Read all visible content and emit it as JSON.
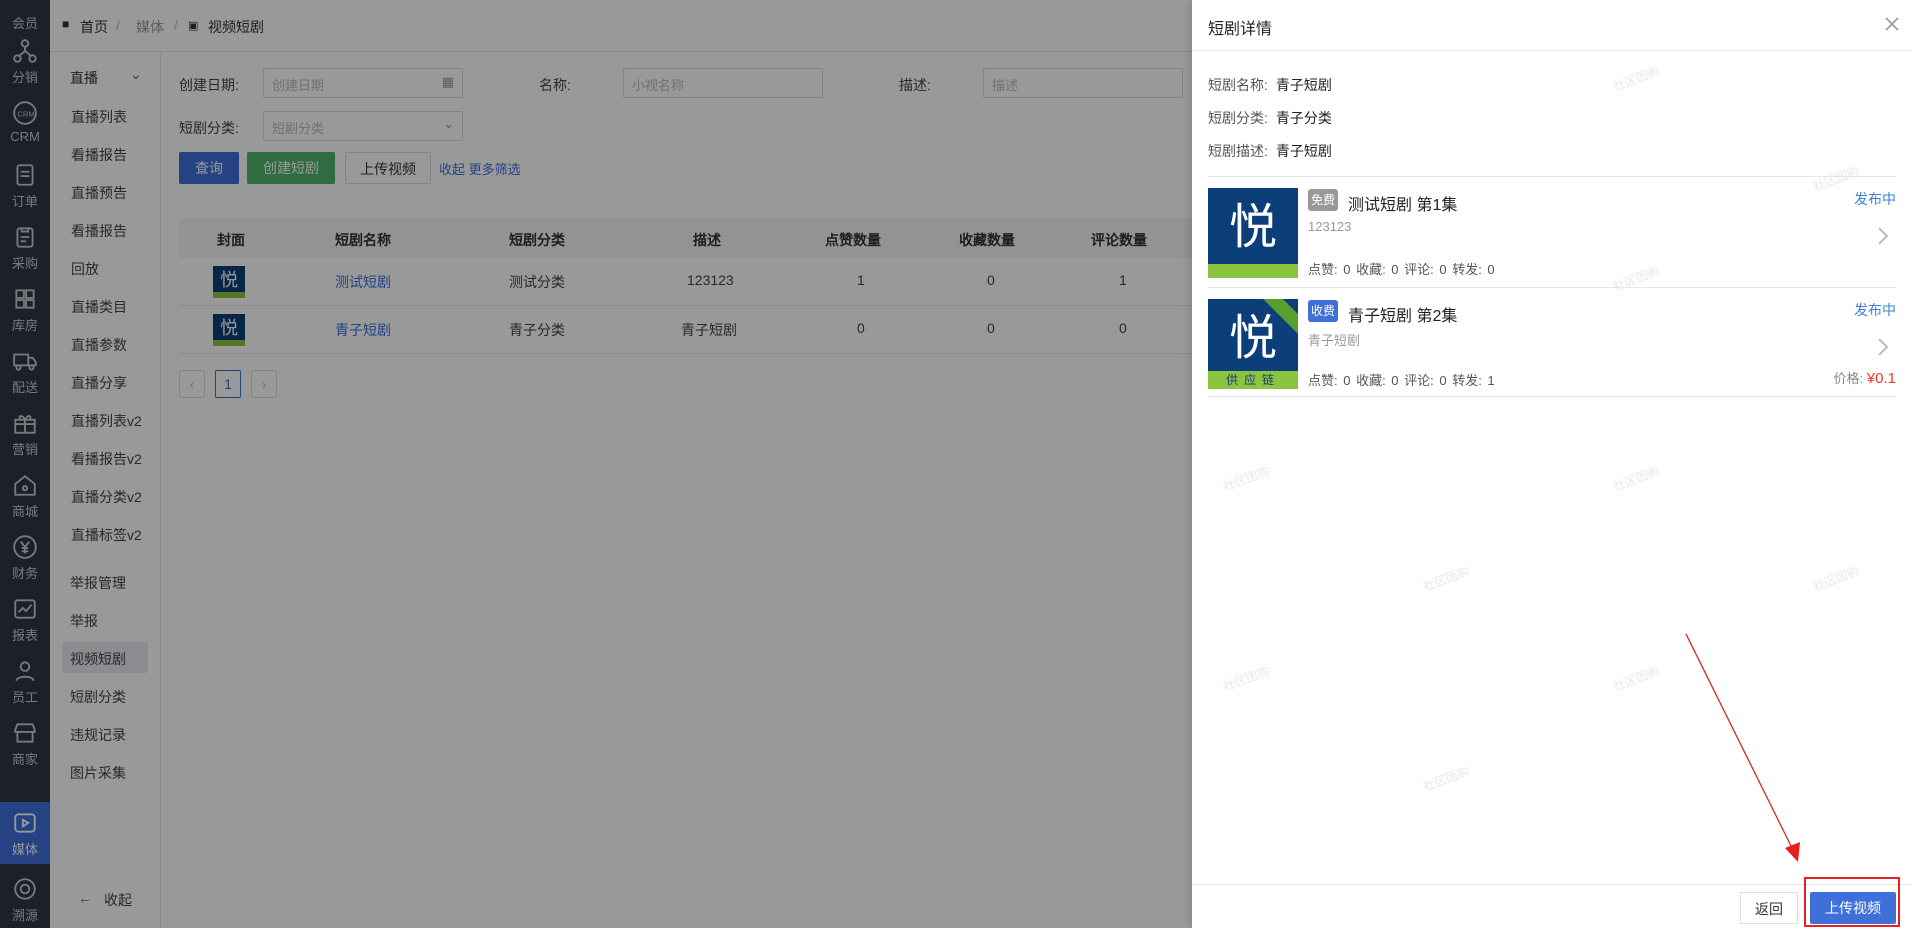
{
  "rail": [
    {
      "label": "会员",
      "icon": "member-icon"
    },
    {
      "label": "分销",
      "icon": "distribution-icon"
    },
    {
      "label": "CRM",
      "icon": "crm-icon"
    },
    {
      "label": "订单",
      "icon": "order-icon"
    },
    {
      "label": "采购",
      "icon": "purchase-icon"
    },
    {
      "label": "库房",
      "icon": "warehouse-icon"
    },
    {
      "label": "配送",
      "icon": "delivery-icon"
    },
    {
      "label": "营销",
      "icon": "gift-icon"
    },
    {
      "label": "商城",
      "icon": "mall-icon"
    },
    {
      "label": "财务",
      "icon": "finance-icon"
    },
    {
      "label": "报表",
      "icon": "report-icon"
    },
    {
      "label": "员工",
      "icon": "staff-icon"
    },
    {
      "label": "商家",
      "icon": "shop-icon"
    },
    {
      "label": "媒体",
      "icon": "media-icon"
    },
    {
      "label": "溯源",
      "icon": "trace-icon"
    }
  ],
  "breadcrumb": {
    "home": "首页",
    "media": "媒体",
    "current": "视频短剧"
  },
  "subnav": {
    "group": "直播",
    "items": [
      "直播列表",
      "看播报告",
      "直播预告",
      "看播报告",
      "回放",
      "直播类目",
      "直播参数",
      "直播分享",
      "直播列表v2",
      "看播报告v2",
      "直播分类v2",
      "直播标签v2"
    ],
    "items2": [
      "举报管理",
      "举报",
      "视频短剧",
      "短剧分类",
      "违规记录",
      "图片采集"
    ],
    "collapse": "收起"
  },
  "filters": {
    "date_label": "创建日期:",
    "date_placeholder": "创建日期",
    "name_label": "名称:",
    "name_placeholder": "小视名称",
    "desc_label": "描述:",
    "desc_placeholder": "描述",
    "cat_label": "短剧分类:",
    "cat_placeholder": "短剧分类",
    "query": "查询",
    "create": "创建短剧",
    "upload": "上传视频",
    "more": "收起 更多筛选"
  },
  "table": {
    "headers": [
      "封面",
      "短剧名称",
      "短剧分类",
      "描述",
      "点赞数量",
      "收藏数量",
      "评论数量"
    ],
    "rows": [
      {
        "name": "测试短剧",
        "category": "测试分类",
        "desc": "123123",
        "likes": "1",
        "favs": "0",
        "comments": "1"
      },
      {
        "name": "青子短剧",
        "category": "青子分类",
        "desc": "青子短剧",
        "likes": "0",
        "favs": "0",
        "comments": "0"
      }
    ],
    "page": "1"
  },
  "drawer": {
    "title": "短剧详情",
    "name_k": "短剧名称:",
    "name_v": "青子短剧",
    "cat_k": "短剧分类:",
    "cat_v": "青子分类",
    "desc_k": "短剧描述:",
    "desc_v": "青子短剧",
    "episodes": [
      {
        "badge": "免费",
        "badge_color": "#999999",
        "title": "测试短剧 第1集",
        "desc": "123123",
        "stats": "点赞: 0 收藏: 0 评论: 0 转发: 0",
        "status": "发布中",
        "thumb_char": "悦"
      },
      {
        "badge": "收费",
        "badge_color": "#3f6fd9",
        "title": "青子短剧 第2集",
        "desc": "青子短剧",
        "stats": "点赞: 0 收藏: 0 评论: 0 转发: 1",
        "status": "发布中",
        "price_label": "价格:",
        "price": "¥0.1",
        "thumb_char": "悦",
        "thumb_band": "供应链"
      }
    ],
    "back": "返回",
    "upload": "上传视频",
    "watermark": "社区团购"
  },
  "colors": {
    "primary": "#3f6fd9",
    "success": "#52b26b",
    "danger": "#e33333"
  }
}
